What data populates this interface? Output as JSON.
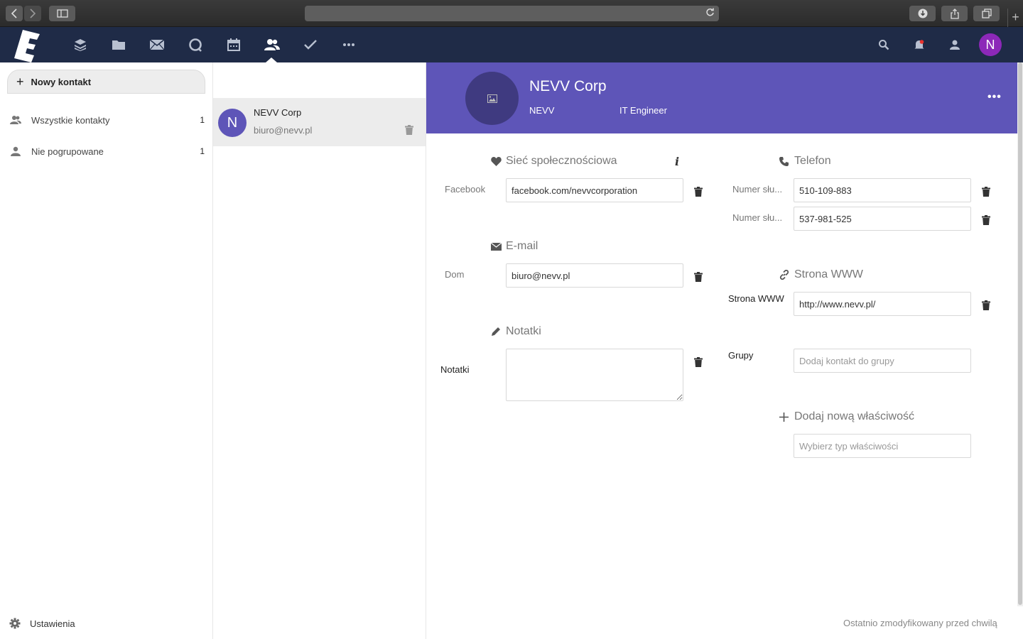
{
  "browser": {
    "back_icon": "chevron-left-icon",
    "forward_icon": "chevron-right-icon",
    "sidebar_icon": "sidebar-icon",
    "reload_icon": "reload-icon",
    "download_icon": "download-icon",
    "share_icon": "share-icon",
    "tabs_icon": "tabs-icon",
    "newtab_label": "+"
  },
  "header": {
    "nav": [
      "dashboard-icon",
      "files-icon",
      "mail-icon",
      "talk-icon",
      "calendar-icon",
      "contacts-icon",
      "tasks-icon",
      "more-icon"
    ],
    "active": "contacts-icon",
    "avatar_letter": "N",
    "avatar_color": "#8c28b8"
  },
  "sidebar": {
    "new_contact_label": "Nowy kontakt",
    "items": [
      {
        "label": "Wszystkie kontakty",
        "count": "1",
        "icon": "group-icon"
      },
      {
        "label": "Nie pogrupowane",
        "count": "1",
        "icon": "user-icon"
      }
    ],
    "settings_label": "Ustawienia"
  },
  "contact_list": {
    "items": [
      {
        "initial": "N",
        "name": "NEVV Corp",
        "email": "biuro@nevv.pl"
      }
    ]
  },
  "details": {
    "name": "NEVV Corp",
    "org": "NEVV",
    "title": "IT Engineer",
    "menu_label": "•••",
    "social": {
      "title": "Sieć społecznościowa",
      "info_label": "i",
      "label": "Facebook",
      "value": "facebook.com/nevvcorporation"
    },
    "email": {
      "title": "E-mail",
      "label": "Dom",
      "value": "biuro@nevv.pl"
    },
    "notes": {
      "title": "Notatki",
      "label": "Notatki",
      "value": ""
    },
    "phone": {
      "title": "Telefon",
      "items": [
        {
          "label": "Numer słu...",
          "value": "510-109-883"
        },
        {
          "label": "Numer słu...",
          "value": "537-981-525"
        }
      ]
    },
    "website": {
      "title": "Strona WWW",
      "label": "Strona WWW",
      "value": "http://www.nevv.pl/"
    },
    "groups": {
      "label": "Grupy",
      "placeholder": "Dodaj kontakt do grupy"
    },
    "add_property": {
      "title": "Dodaj nową właściwość",
      "placeholder": "Wybierz typ właściwości"
    },
    "footer": "Ostatnio zmodyfikowany przed chwilą"
  },
  "colors": {
    "header_bg": "#1f2b47",
    "accent": "#5e55b8"
  }
}
